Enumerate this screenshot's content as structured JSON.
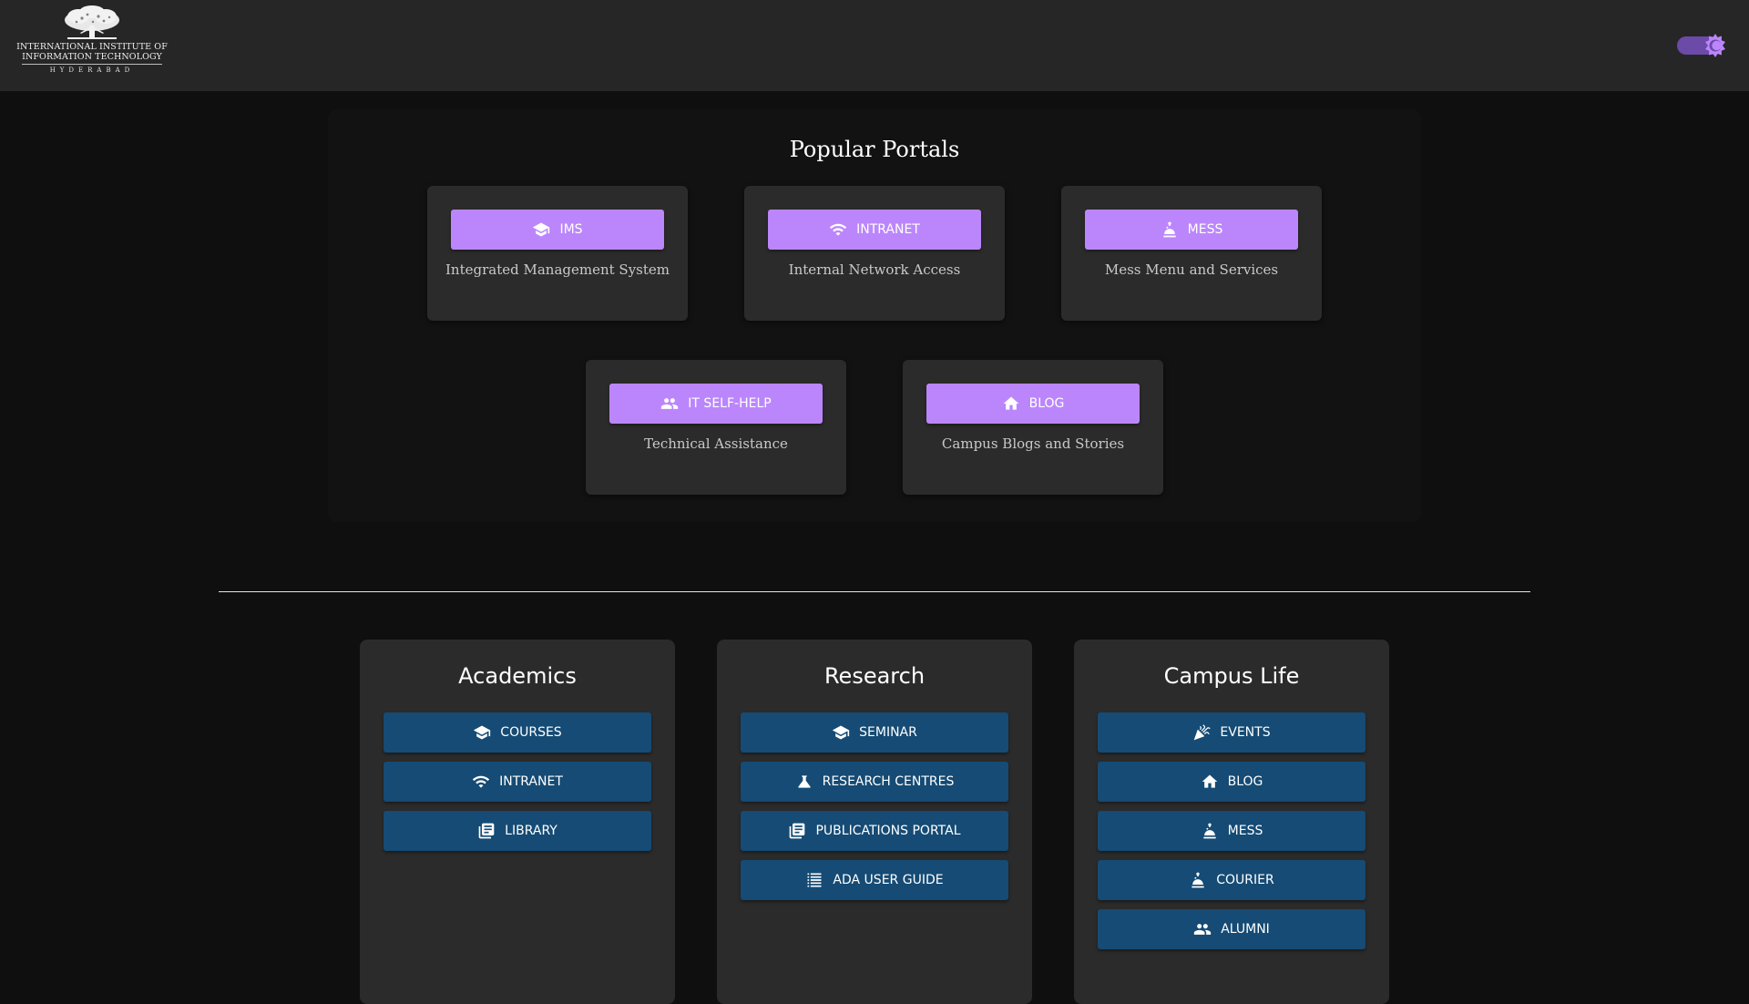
{
  "header": {
    "logo": {
      "line1": "INTERNATIONAL INSTITUTE OF",
      "line2": "INFORMATION TECHNOLOGY",
      "line3": "HYDERABAD",
      "icon": "tree-icon"
    },
    "theme_toggle": {
      "state": "on",
      "icon": "sun-icon",
      "track_color": "#6c4aa8",
      "knob_color": "#bb86fc"
    }
  },
  "popular_portals": {
    "title": "Popular Portals",
    "button_color": "#bb86fc",
    "items": [
      {
        "label": "IMS",
        "description": "Integrated Management System",
        "icon": "graduation-cap-icon"
      },
      {
        "label": "INTRANET",
        "description": "Internal Network Access",
        "icon": "wifi-icon"
      },
      {
        "label": "MESS",
        "description": "Mess Menu and Services",
        "icon": "food-service-icon"
      },
      {
        "label": "IT SELF-HELP",
        "description": "Technical Assistance",
        "icon": "people-icon"
      },
      {
        "label": "BLOG",
        "description": "Campus Blogs and Stories",
        "icon": "home-icon"
      }
    ]
  },
  "sections": {
    "button_color": "#154b74",
    "items": [
      {
        "title": "Academics",
        "links": [
          {
            "label": "COURSES",
            "icon": "graduation-cap-icon"
          },
          {
            "label": "INTRANET",
            "icon": "wifi-icon"
          },
          {
            "label": "LIBRARY",
            "icon": "library-books-icon"
          }
        ]
      },
      {
        "title": "Research",
        "links": [
          {
            "label": "SEMINAR",
            "icon": "graduation-cap-icon"
          },
          {
            "label": "RESEARCH CENTRES",
            "icon": "flask-icon"
          },
          {
            "label": "PUBLICATIONS PORTAL",
            "icon": "library-books-icon"
          },
          {
            "label": "ADA USER GUIDE",
            "icon": "list-icon"
          }
        ]
      },
      {
        "title": "Campus Life",
        "links": [
          {
            "label": "EVENTS",
            "icon": "celebration-icon"
          },
          {
            "label": "BLOG",
            "icon": "home-icon"
          },
          {
            "label": "MESS",
            "icon": "food-service-icon"
          },
          {
            "label": "COURIER",
            "icon": "food-service-icon"
          },
          {
            "label": "ALUMNI",
            "icon": "people-icon"
          }
        ]
      }
    ]
  }
}
